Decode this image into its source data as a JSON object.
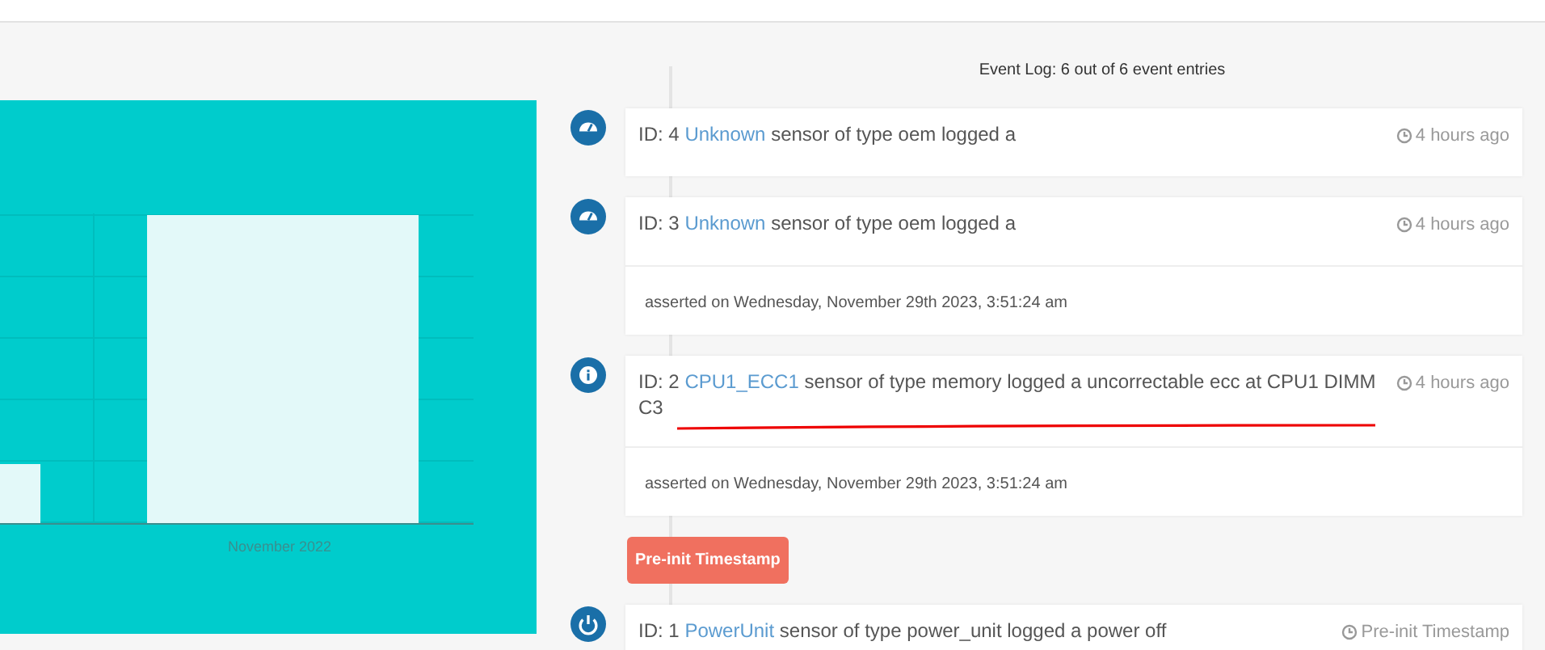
{
  "event_log": {
    "title": "Event Log: 6 out of 6 event entries",
    "entries": [
      {
        "kind": "gauge",
        "prefix": "ID: 4",
        "sensor": "Unknown",
        "message": "sensor of type oem logged a",
        "time": "4 hours ago"
      },
      {
        "kind": "gauge",
        "prefix": "ID: 3",
        "sensor": "Unknown",
        "message": "sensor of type oem logged a",
        "time": "4 hours ago",
        "footer": "asserted on Wednesday, November 29th 2023, 3:51:24 am"
      },
      {
        "kind": "info",
        "prefix": "ID: 2",
        "sensor": "CPU1_ECC1",
        "message": "sensor of type memory logged a uncorrectable ecc at CPU1 DIMM C3",
        "time": "4 hours ago",
        "footer": "asserted on Wednesday, November 29th 2023, 3:51:24 am",
        "underlined": true
      },
      {
        "kind": "marker",
        "label": "Pre-init Timestamp"
      },
      {
        "kind": "power",
        "prefix": "ID: 1",
        "sensor": "PowerUnit",
        "message": "sensor of type power_unit logged a power off",
        "time": "Pre-init Timestamp"
      }
    ]
  },
  "chart": {
    "category": "November 2022"
  }
}
